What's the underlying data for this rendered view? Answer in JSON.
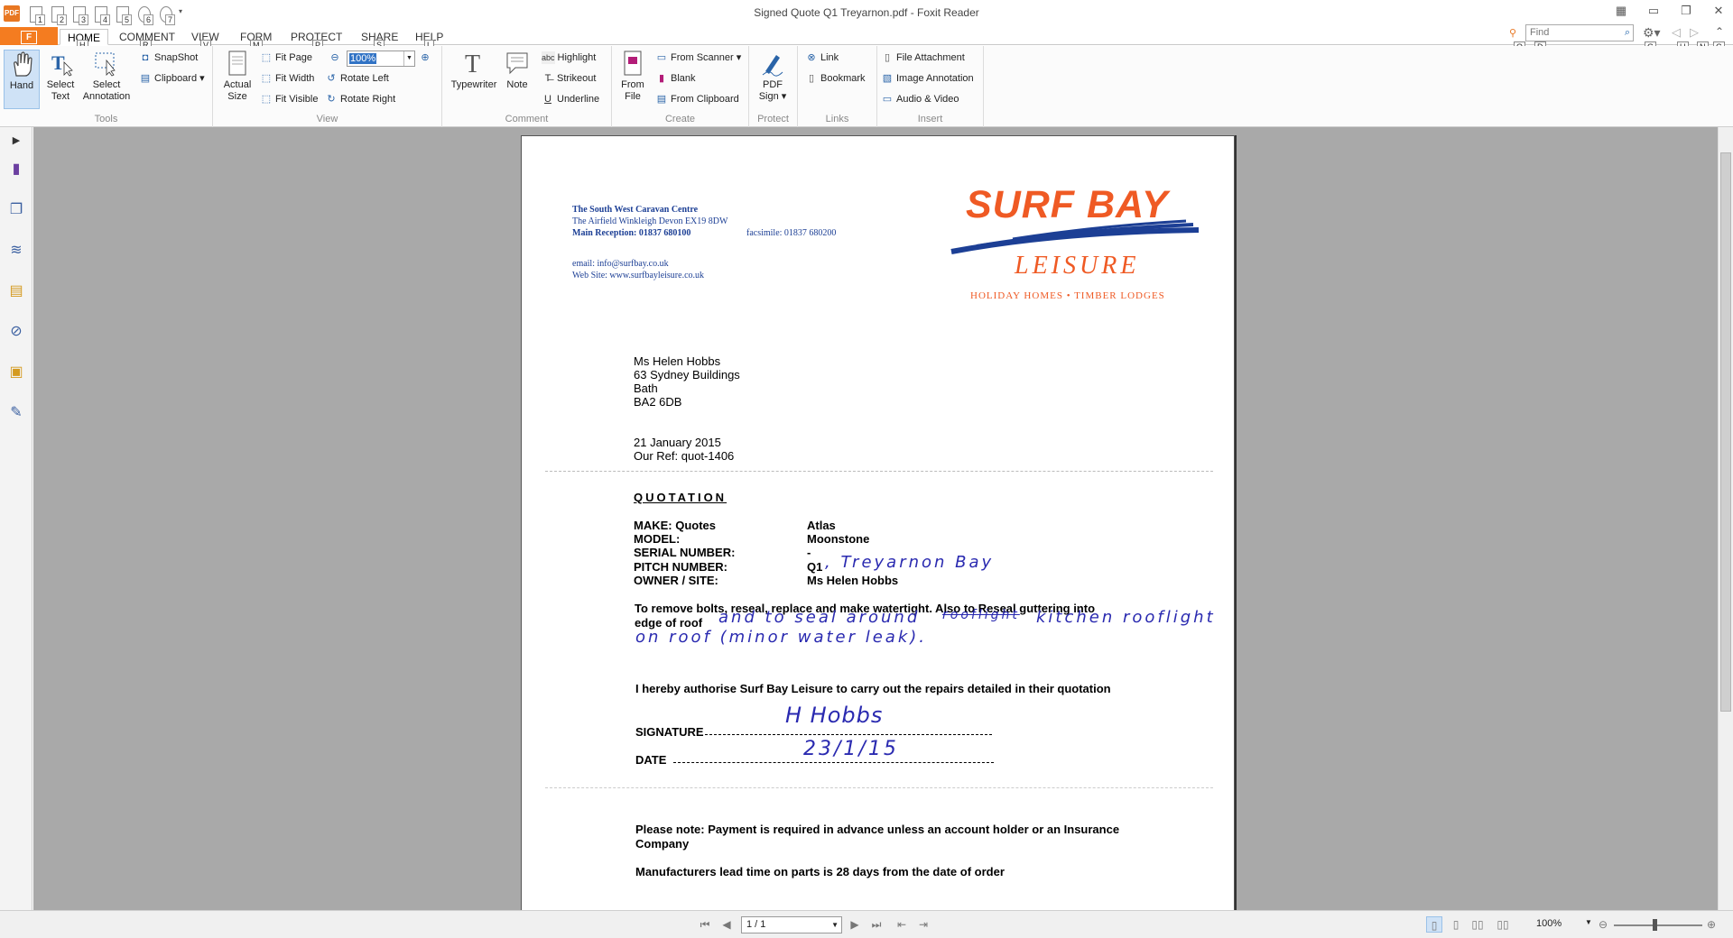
{
  "window": {
    "title": "Signed Quote Q1 Treyarnon.pdf - Foxit Reader"
  },
  "quick_access": [
    {
      "label": "1",
      "icon": "open-icon"
    },
    {
      "label": "2",
      "icon": "save-icon"
    },
    {
      "label": "3",
      "icon": "print-icon"
    },
    {
      "label": "4",
      "icon": "email-icon"
    },
    {
      "label": "5",
      "icon": "document-icon"
    },
    {
      "label": "6",
      "icon": "undo-icon"
    },
    {
      "label": "7",
      "icon": "redo-icon"
    }
  ],
  "tabs": {
    "file": "F",
    "items": [
      {
        "label": "HOME",
        "key": "H"
      },
      {
        "label": "COMMENT",
        "key": "R"
      },
      {
        "label": "VIEW",
        "key": "V"
      },
      {
        "label": "FORM",
        "key": "M"
      },
      {
        "label": "PROTECT",
        "key": "P"
      },
      {
        "label": "SHARE",
        "key": "S"
      },
      {
        "label": "HELP",
        "key": "L"
      }
    ]
  },
  "find": {
    "placeholder": "Find",
    "key_q": "Q",
    "key_d": "D",
    "key_g": "G",
    "key_u": "U",
    "key_n": "N",
    "key_c": "C"
  },
  "ribbon": {
    "tools": {
      "label": "Tools",
      "hand": "Hand",
      "select_text_1": "Select",
      "select_text_2": "Text",
      "select_annot_1": "Select",
      "select_annot_2": "Annotation",
      "snapshot": "SnapShot",
      "clipboard": "Clipboard"
    },
    "view": {
      "label": "View",
      "actual_1": "Actual",
      "actual_2": "Size",
      "fit_page": "Fit Page",
      "fit_width": "Fit Width",
      "fit_visible": "Fit Visible",
      "zoom": "100%",
      "rotate_left": "Rotate Left",
      "rotate_right": "Rotate Right"
    },
    "comment": {
      "label": "Comment",
      "typewriter": "Typewriter",
      "note": "Note",
      "highlight": "Highlight",
      "strikeout": "Strikeout",
      "underline": "Underline"
    },
    "create": {
      "label": "Create",
      "from_file_1": "From",
      "from_file_2": "File",
      "from_scanner": "From Scanner",
      "blank": "Blank",
      "from_clipboard": "From Clipboard"
    },
    "protect": {
      "label": "Protect",
      "pdf_sign_1": "PDF",
      "pdf_sign_2": "Sign"
    },
    "links": {
      "label": "Links",
      "link": "Link",
      "bookmark": "Bookmark"
    },
    "insert": {
      "label": "Insert",
      "file_attachment": "File Attachment",
      "image_annotation": "Image Annotation",
      "audio_video": "Audio & Video"
    }
  },
  "document": {
    "company": {
      "name": "The South West Caravan Centre",
      "address": "The Airfield Winkleigh Devon EX19 8DW",
      "reception": "Main Reception: 01837 680100",
      "facsimile": "facsimile: 01837 680200",
      "email": "email: info@surfbay.co.uk",
      "web": "Web Site: www.surfbayleisure.co.uk"
    },
    "logo": {
      "title": "SURF BAY",
      "subtitle": "LEISURE",
      "tagline": "HOLIDAY HOMES • TIMBER LODGES"
    },
    "recipient": [
      "Ms Helen Hobbs",
      "63 Sydney Buildings",
      "Bath",
      "BA2 6DB"
    ],
    "date": "21 January 2015",
    "ref": "Our Ref: quot-1406",
    "heading": "QUOTATION",
    "fields": [
      {
        "label": "MAKE: Quotes",
        "value": "Atlas"
      },
      {
        "label": "MODEL:",
        "value": "Moonstone"
      },
      {
        "label": "SERIAL NUMBER:",
        "value": "-"
      },
      {
        "label": "PITCH NUMBER:",
        "value": "Q1"
      },
      {
        "label": "OWNER / SITE:",
        "value": "Ms Helen Hobbs"
      }
    ],
    "handwritten_pitch": ", Treyarnon Bay",
    "description_1": "To remove bolts, reseal, replace and make watertight.  Also to Reseal guttering into",
    "description_2": "edge of roof",
    "handwritten_desc_1": "and to seal around",
    "handwritten_desc_strike": "rooflight",
    "handwritten_desc_2": "kitchen rooflight",
    "handwritten_desc_3": "on roof (minor water leak).",
    "authorise": "I hereby authorise Surf Bay Leisure to carry out the repairs detailed in their quotation",
    "signature_label": "SIGNATURE",
    "date_label": "DATE",
    "handwritten_signature": "H Hobbs",
    "handwritten_date": "23/1/15",
    "note_1": "Please note:  Payment is required in advance unless an account holder or an Insurance",
    "note_2": "Company",
    "lead_time": "Manufacturers lead time on parts is 28 days from the date of order"
  },
  "status": {
    "page": "1 / 1",
    "zoom": "100%"
  }
}
